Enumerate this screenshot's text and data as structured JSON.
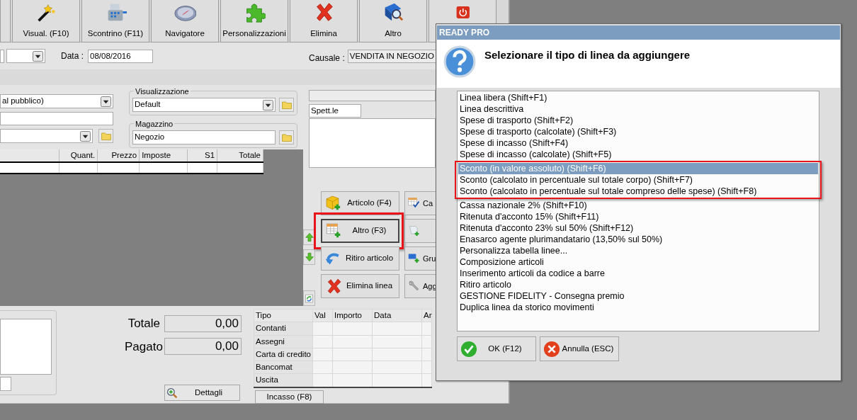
{
  "toolbar": [
    {
      "label": "Visual. (F10)"
    },
    {
      "label": "Scontrino (F11)"
    },
    {
      "label": "Navigatore"
    },
    {
      "label": "Personalizzazioni"
    },
    {
      "label": "Elimina"
    },
    {
      "label": "Altro"
    }
  ],
  "header": {
    "date_label": "Data :",
    "date": "08/08/2016",
    "causale_label": "Causale :",
    "causale": "VENDITA IN NEGOZIO"
  },
  "listino": {
    "value": "al pubblico)"
  },
  "visualizzazione": {
    "legend": "Visualizzazione",
    "value": "Default"
  },
  "magazzino": {
    "legend": "Magazzino",
    "value": "Negozio"
  },
  "recipient": {
    "salutation": "Spett.le"
  },
  "lines_table": {
    "columns": [
      "Quant.",
      "Prezzo",
      "Imposte",
      "S1",
      "Totale"
    ]
  },
  "line_buttons": [
    {
      "label": "Articolo (F4)",
      "highlighted": false
    },
    {
      "label": "Altro (F3)",
      "highlighted": true
    },
    {
      "label": "Ritiro articolo",
      "highlighted": false
    },
    {
      "label": "Elimina linea",
      "highlighted": false
    }
  ],
  "side_buttons": [
    {
      "kind": "text",
      "label": "Ca"
    },
    {
      "kind": "icon"
    },
    {
      "kind": "text",
      "label": "Gru"
    },
    {
      "kind": "text",
      "label": "Agg"
    }
  ],
  "totals": [
    {
      "label": "Totale",
      "value": "0,00"
    },
    {
      "label": "Pagato",
      "value": "0,00"
    }
  ],
  "details_button": "Dettagli",
  "payments": {
    "columns": [
      "Tipo",
      "Val",
      "Importo",
      "Data",
      "Ar"
    ],
    "rows": [
      "Contanti",
      "Assegni",
      "Carta di credito",
      "Bancomat",
      "Uscita"
    ]
  },
  "cash_button": "Incasso (F8)",
  "dialog": {
    "title": "READY PRO",
    "prompt": "Selezionare il tipo di linea da aggiungere",
    "items": [
      {
        "label": "Linea libera (Shift+F1)",
        "selected": false,
        "highlighted": false
      },
      {
        "label": "Linea descrittiva",
        "selected": false,
        "highlighted": false
      },
      {
        "label": "Spese di trasporto (Shift+F2)",
        "selected": false,
        "highlighted": false
      },
      {
        "label": "Spese di trasporto (calcolate) (Shift+F3)",
        "selected": false,
        "highlighted": false
      },
      {
        "label": "Spese di incasso (Shift+F4)",
        "selected": false,
        "highlighted": false
      },
      {
        "label": "Spese di incasso (calcolate) (Shift+F5)",
        "selected": false,
        "highlighted": false
      },
      {
        "label": "Sconto (in valore assoluto) (Shift+F6)",
        "selected": true,
        "highlighted": true
      },
      {
        "label": "Sconto (calcolato in percentuale sul totale corpo) (Shift+F7)",
        "selected": false,
        "highlighted": true
      },
      {
        "label": "Sconto (calcolato in percentuale sul totale compreso delle spese) (Shift+F8)",
        "selected": false,
        "highlighted": true
      },
      {
        "label": "Cassa nazionale 2% (Shift+F10)",
        "selected": false,
        "highlighted": false
      },
      {
        "label": "Ritenuta d'acconto 15% (Shift+F11)",
        "selected": false,
        "highlighted": false
      },
      {
        "label": "Ritenuta d'acconto 23% sul 50% (Shift+F12)",
        "selected": false,
        "highlighted": false
      },
      {
        "label": "Enasarco agente plurimandatario (13,50% sul 50%)",
        "selected": false,
        "highlighted": false
      },
      {
        "label": "Personalizza tabella linee...",
        "selected": false,
        "highlighted": false
      },
      {
        "label": "Composizione articoli",
        "selected": false,
        "highlighted": false
      },
      {
        "label": "Inserimento articoli da codice a barre",
        "selected": false,
        "highlighted": false
      },
      {
        "label": "Ritiro articolo",
        "selected": false,
        "highlighted": false
      },
      {
        "label": "GESTIONE FIDELITY - Consegna premio",
        "selected": false,
        "highlighted": false
      },
      {
        "label": "Duplica linea da storico movimenti",
        "selected": false,
        "highlighted": false
      }
    ],
    "buttons": [
      {
        "label": "OK (F12)",
        "kind": "ok"
      },
      {
        "label": "Annulla (ESC)",
        "kind": "cancel"
      }
    ]
  }
}
